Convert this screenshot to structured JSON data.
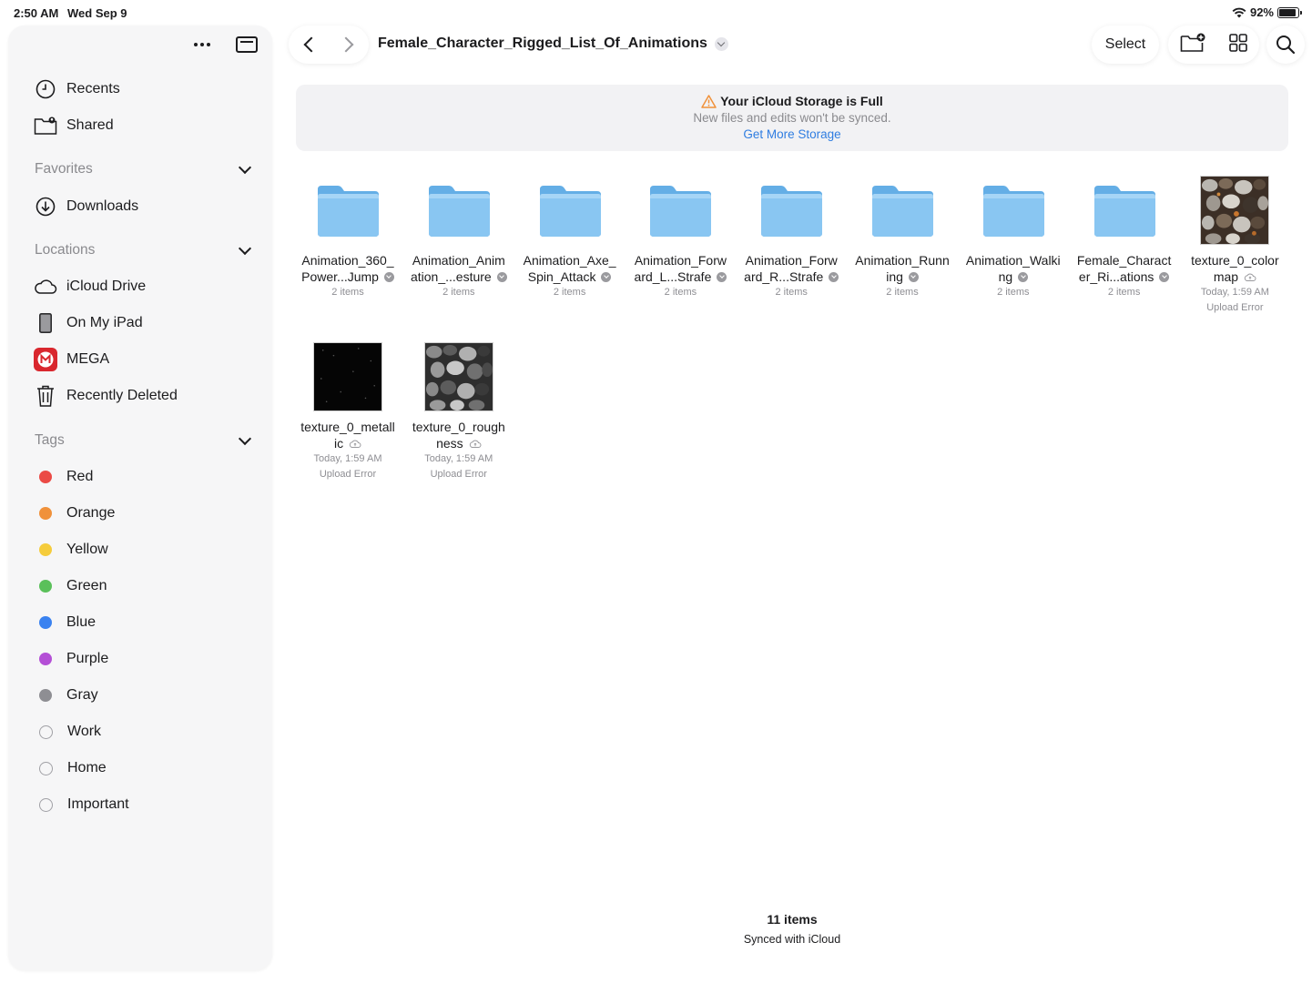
{
  "status": {
    "time": "2:50 AM",
    "date": "Wed Sep 9",
    "battery": "92%",
    "battery_level": 0.92
  },
  "sidebar": {
    "top": [
      {
        "label": "Recents",
        "icon": "clock-icon"
      },
      {
        "label": "Shared",
        "icon": "shared-folder-icon"
      }
    ],
    "favorites": {
      "title": "Favorites",
      "items": [
        {
          "label": "Downloads",
          "icon": "download-icon"
        }
      ]
    },
    "locations": {
      "title": "Locations",
      "items": [
        {
          "label": "iCloud Drive",
          "icon": "cloud-icon"
        },
        {
          "label": "On My iPad",
          "icon": "ipad-icon"
        },
        {
          "label": "MEGA",
          "icon": "mega-icon"
        },
        {
          "label": "Recently Deleted",
          "icon": "trash-icon"
        }
      ]
    },
    "tags": {
      "title": "Tags",
      "items": [
        {
          "label": "Red",
          "color": "#eb4a45"
        },
        {
          "label": "Orange",
          "color": "#f0913a"
        },
        {
          "label": "Yellow",
          "color": "#f5cc3c"
        },
        {
          "label": "Green",
          "color": "#5ac05a"
        },
        {
          "label": "Blue",
          "color": "#3a82f0"
        },
        {
          "label": "Purple",
          "color": "#b44fd6"
        },
        {
          "label": "Gray",
          "color": "#8e8e93"
        },
        {
          "label": "Work",
          "color": ""
        },
        {
          "label": "Home",
          "color": ""
        },
        {
          "label": "Important",
          "color": ""
        }
      ]
    }
  },
  "toolbar": {
    "title": "Female_Character_Rigged_List_Of_Animations",
    "select_label": "Select"
  },
  "banner": {
    "title": "Your iCloud Storage is Full",
    "subtitle": "New files and edits won't be synced.",
    "link": "Get More Storage"
  },
  "files": [
    {
      "line1": "Animation_360_",
      "line2": "Power...Jump",
      "meta1": "2 items",
      "meta2": "",
      "kind": "folder"
    },
    {
      "line1": "Animation_Anim",
      "line2": "ation_...esture",
      "meta1": "2 items",
      "meta2": "",
      "kind": "folder"
    },
    {
      "line1": "Animation_Axe_",
      "line2": "Spin_Attack",
      "meta1": "2 items",
      "meta2": "",
      "kind": "folder"
    },
    {
      "line1": "Animation_Forw",
      "line2": "ard_L...Strafe",
      "meta1": "2 items",
      "meta2": "",
      "kind": "folder"
    },
    {
      "line1": "Animation_Forw",
      "line2": "ard_R...Strafe",
      "meta1": "2 items",
      "meta2": "",
      "kind": "folder"
    },
    {
      "line1": "Animation_Runn",
      "line2": "ing",
      "meta1": "2 items",
      "meta2": "",
      "kind": "folder"
    },
    {
      "line1": "Animation_Walki",
      "line2": "ng",
      "meta1": "2 items",
      "meta2": "",
      "kind": "folder"
    },
    {
      "line1": "Female_Charact",
      "line2": "er_Ri...ations",
      "meta1": "2 items",
      "meta2": "",
      "kind": "folder"
    },
    {
      "line1": "texture_0_color",
      "line2": "map",
      "meta1": "Today, 1:59 AM",
      "meta2": "Upload Error",
      "kind": "colormap"
    },
    {
      "line1": "texture_0_metall",
      "line2": "ic",
      "meta1": "Today, 1:59 AM",
      "meta2": "Upload Error",
      "kind": "metallic"
    },
    {
      "line1": "texture_0_rough",
      "line2": "ness",
      "meta1": "Today, 1:59 AM",
      "meta2": "Upload Error",
      "kind": "roughness"
    }
  ],
  "footer": {
    "count": "11 items",
    "sync": "Synced with iCloud"
  }
}
